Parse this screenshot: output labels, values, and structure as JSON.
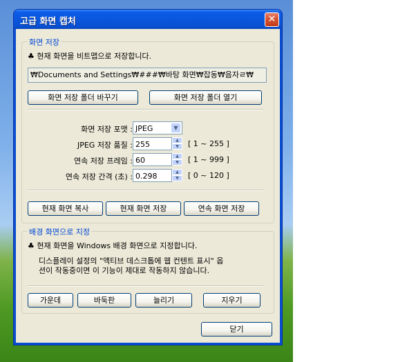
{
  "window": {
    "title": "고급 화면 캡처",
    "close_glyph": "✕"
  },
  "save_group": {
    "legend": "화면 저장",
    "description": "♣ 현재 화면을 비트맵으로 저장합니다.",
    "path": "₩Documents and Settings₩###₩바탕 화면₩잡동₩음자ㄹ₩",
    "change_folder_label": "화면 저장 폴더 바꾸기",
    "open_folder_label": "화면 저장 폴더 열기",
    "format_label": "화면 저장 포맷 :",
    "format_value": "JPEG",
    "quality_label": "JPEG 저장 품질 :",
    "quality_value": "255",
    "quality_range": "[ 1 ~ 255 ]",
    "frames_label": "연속 저장 프레임 :",
    "frames_value": "60",
    "frames_range": "[ 1 ~ 999 ]",
    "interval_label": "연속 저장 간격 (초) :",
    "interval_value": "0.298",
    "interval_range": "[ 0 ~ 120 ]",
    "copy_label": "현재 화면 복사",
    "save_label": "현재 화면 저장",
    "continuous_label": "연속 화면 저장"
  },
  "wallpaper_group": {
    "legend": "배경 화면으로 지정",
    "description": "♣ 현재 화면을 Windows 배경 화면으로 지정합니다.",
    "note_line1": "디스플레이 설정의 \"액티브 데스크톱에 웹 컨텐트 표시\" 옵",
    "note_line2": "션이 작동중이면 이 기능이 제대로 작동하지 않습니다.",
    "center_label": "가운데",
    "tile_label": "바둑판",
    "stretch_label": "늘리기",
    "clear_label": "지우기"
  },
  "footer": {
    "close_label": "닫기"
  }
}
